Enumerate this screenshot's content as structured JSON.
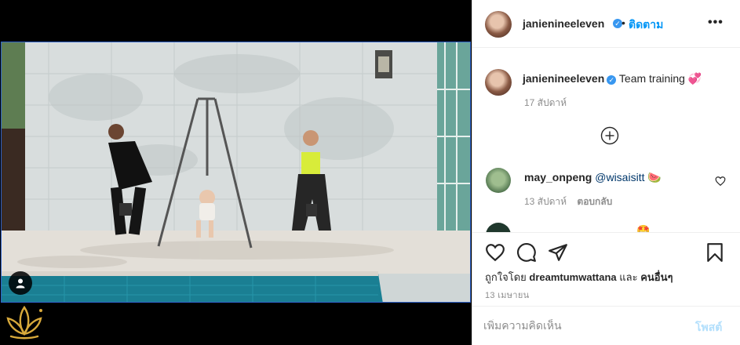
{
  "header": {
    "username": "janienineeleven",
    "verified_glyph": "✓",
    "separator": "•",
    "follow_label": "ติดตาม",
    "more_label": "•••"
  },
  "caption": {
    "username": "janienineeleven",
    "text": "Team training",
    "emoji": "💞",
    "time": "17 สัปดาห์"
  },
  "load_more": {
    "icon": "plus-circle-icon"
  },
  "comments": [
    {
      "username": "may_onpeng",
      "mention": "@wisaisitt",
      "emoji": "🍉",
      "time": "13 สัปดาห์",
      "reply_label": "ตอบกลับ"
    },
    {
      "partial_text": "__________ ___ ____ 🤩"
    }
  ],
  "actions": {
    "icons": [
      "heart-icon",
      "comment-icon",
      "share-icon",
      "save-icon"
    ],
    "liked_by_prefix": "ถูกใจโดย",
    "liked_by_user": "dreamtumwattana",
    "liked_by_suffix_and": "และ",
    "liked_by_others": "คนอื่นๆ",
    "date": "13 เมษายน"
  },
  "comment_box": {
    "placeholder": "เพิ่มความคิดเห็น",
    "post_label": "โพสต์"
  },
  "colors": {
    "accent_blue": "#0095f6",
    "post_disabled": "#b2dffc",
    "muted": "#8e8e8e",
    "text": "#262626",
    "video_border": "#2f62c9"
  }
}
